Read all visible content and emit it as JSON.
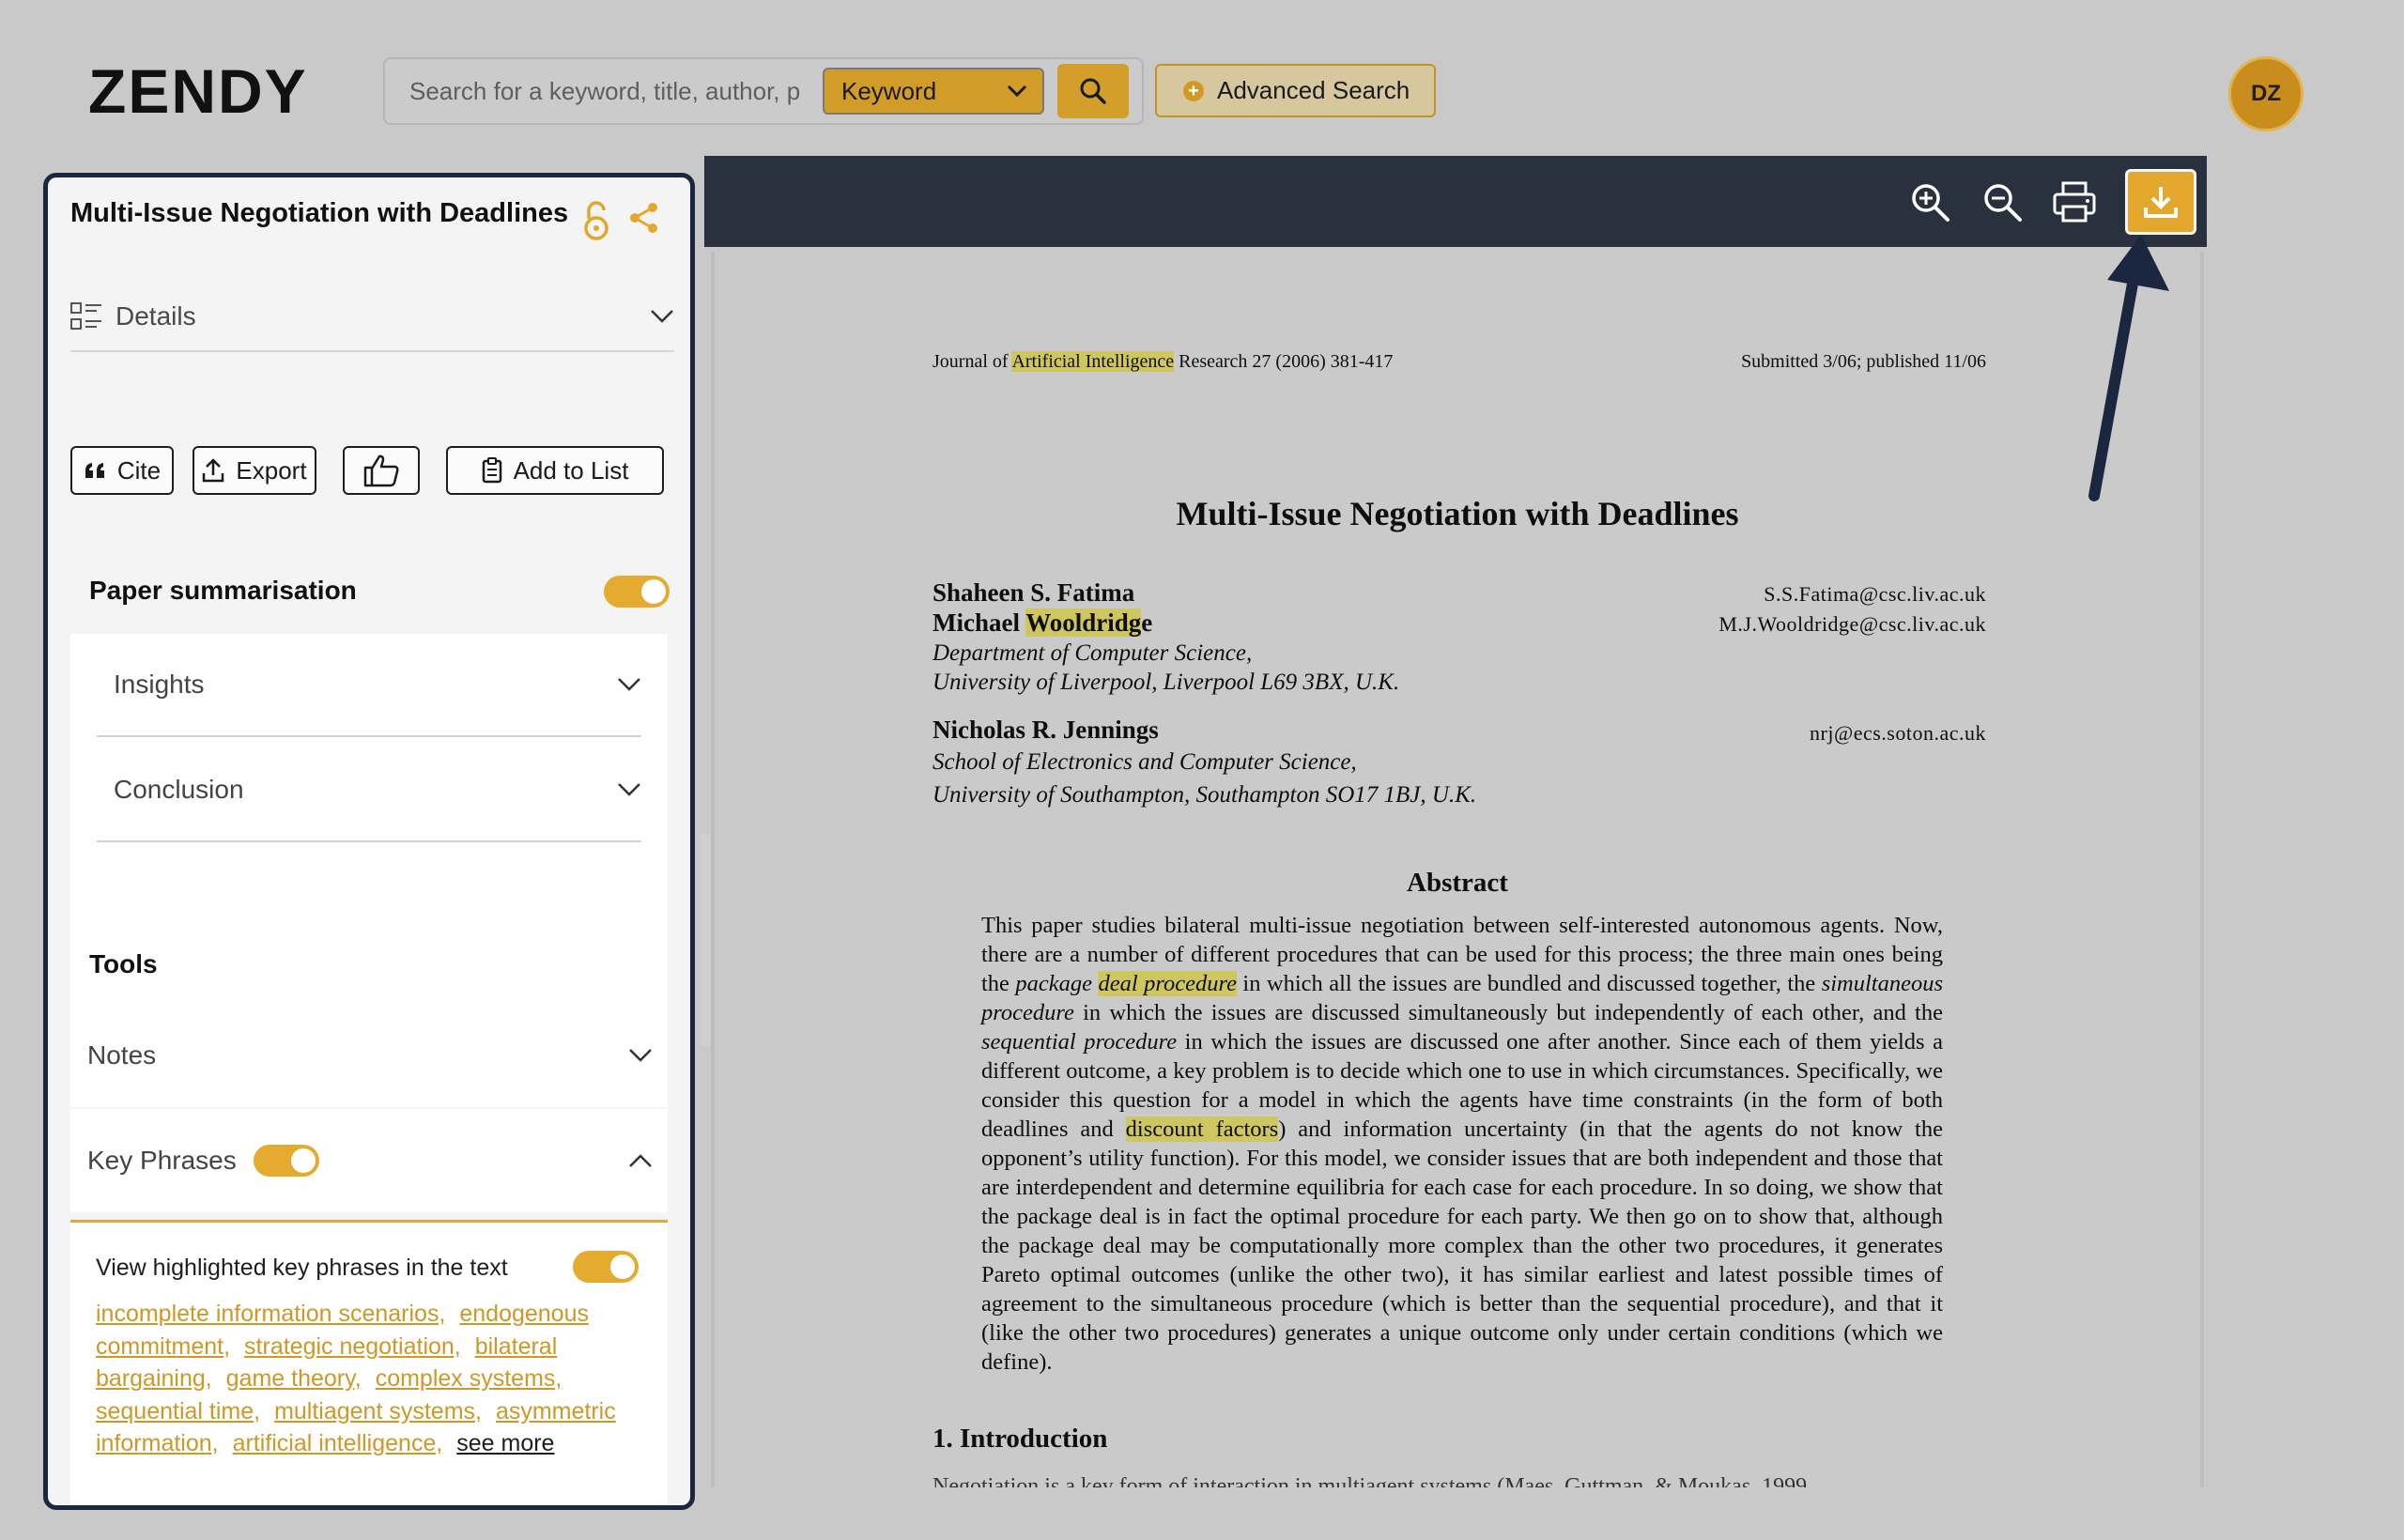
{
  "header": {
    "logo_text": "ZENDY",
    "search_placeholder": "Search for a keyword, title, author, p",
    "search_mode": "Keyword",
    "advanced_search_label": "Advanced Search",
    "avatar_initials": "DZ"
  },
  "left_panel": {
    "title": "Multi-Issue Negotiation with Deadlines",
    "details_label": "Details",
    "actions": {
      "cite": "Cite",
      "export": "Export",
      "add_to_list": "Add to List"
    },
    "summarisation": {
      "label": "Paper summarisation",
      "enabled": true,
      "items": [
        "Insights",
        "Conclusion"
      ]
    },
    "tools": {
      "label": "Tools",
      "notes_label": "Notes",
      "key_phrases_label": "Key Phrases",
      "key_phrases_enabled": true,
      "view_highlighted_label": "View highlighted key phrases in the text",
      "view_highlighted_enabled": true,
      "phrases": [
        "incomplete information scenarios,",
        "endogenous commitment,",
        "strategic negotiation,",
        "bilateral bargaining,",
        "game theory,",
        "complex systems,",
        "sequential time,",
        "multiagent systems,",
        "asymmetric information,",
        "artificial intelligence,"
      ],
      "see_more_label": "see more"
    }
  },
  "viewer": {
    "icons": [
      "zoom-in-icon",
      "zoom-out-icon",
      "print-icon",
      "download-icon"
    ],
    "accent_color": "#e2a72c",
    "document": {
      "journal_pre": "Journal of ",
      "journal_hl": "Artificial Intelligence",
      "journal_post": " Research 27 (2006) 381-417",
      "submitted": "Submitted 3/06; published 11/06",
      "title": "Multi-Issue Negotiation with Deadlines",
      "authors": [
        {
          "name": "Shaheen S. Fatima",
          "email": "S.S.Fatima@csc.liv.ac.uk"
        },
        {
          "name_pre": "Michael ",
          "name_hl": "Wooldridg",
          "name_post": "e",
          "email": "M.J.Wooldridge@csc.liv.ac.uk"
        },
        {
          "name": "Nicholas R. Jennings",
          "email": "nrj@ecs.soton.ac.uk"
        }
      ],
      "affil1_line1": "Department of Computer Science,",
      "affil1_line2": "University of Liverpool, Liverpool L69 3BX, U.K.",
      "affil2_line1": "School of Electronics and Computer Science,",
      "affil2_line2": "University of Southampton, Southampton SO17 1BJ, U.K.",
      "abstract_title": "Abstract",
      "abstract": {
        "p1": "This paper studies bilateral multi-issue negotiation between self-interested autonomous agents. Now, there are a number of different procedures that can be used for this process; the three main ones being the ",
        "p1_em": "package",
        "p1_hl": "deal procedure",
        "p2": " in which all the issues are bundled and discussed together, the ",
        "p2_em": "simultaneous procedure",
        "p3": " in which the issues are discussed simultaneously but independently of each other, and the ",
        "p3_em": "sequential procedure",
        "p4": " in which the issues are discussed one after another. Since each of them yields a different outcome, a key problem is to decide which one to use in which circumstances. Specifically, we consider this question for a model in which the agents have time constraints (in the form of both deadlines and ",
        "p4_hl": "discount factors",
        "p5": ") and information uncertainty (in that the agents do not know the opponent’s utility function). For this model, we consider issues that are both independent and those that are interdependent and determine equilibria for each case for each procedure. In so doing, we show that the package deal is in fact the optimal procedure for each party. We then go on to show that, although the package deal may be computationally more complex than the other two procedures, it generates Pareto optimal outcomes (unlike the other two), it has similar earliest and latest possible times of agreement to the simultaneous procedure (which is better than the sequential procedure), and that it (like the other two procedures) generates a unique outcome only under certain conditions (which we define)."
      },
      "section1": "1. Introduction",
      "cut_text": "Negotiation is a key form of interaction in multiagent systems (Maes, Guttman, & Moukas, 1999"
    }
  }
}
